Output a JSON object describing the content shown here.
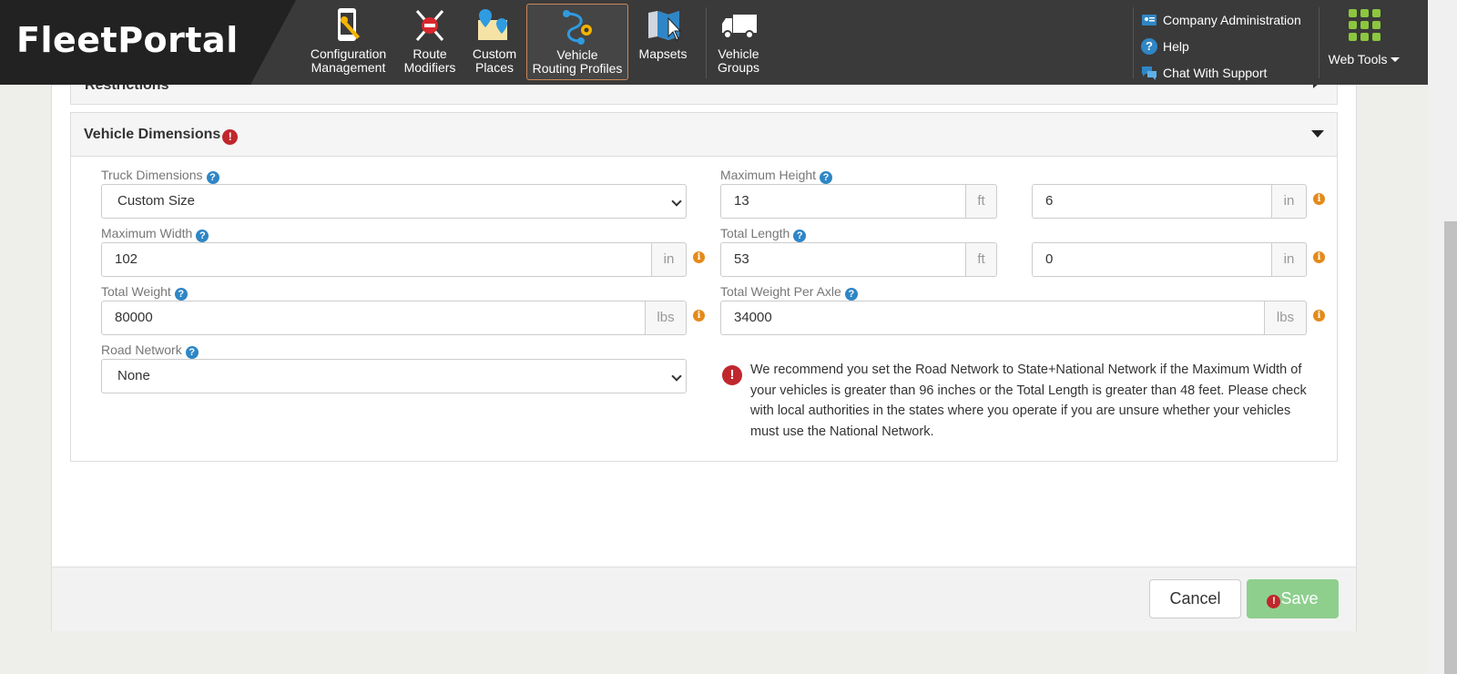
{
  "brand": "FleetPortal",
  "nav": [
    {
      "line1": "Configuration",
      "line2": "Management",
      "icon": "phone-wrench-icon"
    },
    {
      "line1": "Route",
      "line2": "Modifiers",
      "icon": "route-modifiers-icon"
    },
    {
      "line1": "Custom",
      "line2": "Places",
      "icon": "custom-places-icon"
    },
    {
      "line1": "Vehicle",
      "line2": "Routing Profiles",
      "icon": "routing-profiles-icon"
    },
    {
      "line1": "Mapsets",
      "line2": "",
      "icon": "mapsets-icon"
    },
    {
      "line1": "Vehicle",
      "line2": "Groups",
      "icon": "truck-icon"
    }
  ],
  "utility": {
    "company_admin": "Company Administration",
    "help": "Help",
    "chat": "Chat With Support",
    "web_tools": "Web Tools"
  },
  "restrictions": {
    "title": "Restrictions"
  },
  "dimensions": {
    "title": "Vehicle Dimensions",
    "truck_dimensions": {
      "label": "Truck Dimensions",
      "value": "Custom Size"
    },
    "max_width": {
      "label": "Maximum Width",
      "value": "102",
      "unit": "in"
    },
    "total_weight": {
      "label": "Total Weight",
      "value": "80000",
      "unit": "lbs"
    },
    "road_network": {
      "label": "Road Network",
      "value": "None"
    },
    "max_height": {
      "label": "Maximum Height",
      "ft_value": "13",
      "ft_unit": "ft",
      "in_value": "6",
      "in_unit": "in"
    },
    "total_length": {
      "label": "Total Length",
      "ft_value": "53",
      "ft_unit": "ft",
      "in_value": "0",
      "in_unit": "in"
    },
    "weight_per_axle": {
      "label": "Total Weight Per Axle",
      "value": "34000",
      "unit": "lbs"
    },
    "warning": "We recommend you set the Road Network to State+National Network if the Maximum Width of your vehicles is greater than 96 inches or the Total Length is greater than 48 feet. Please check with local authorities in the states where you operate if you are unsure whether your vehicles must use the National Network."
  },
  "footer": {
    "cancel": "Cancel",
    "save": "Save"
  },
  "colors": {
    "accent": "#2f86c6",
    "error": "#c0272d",
    "info": "#e48a1a",
    "save": "#8ecf8e"
  }
}
